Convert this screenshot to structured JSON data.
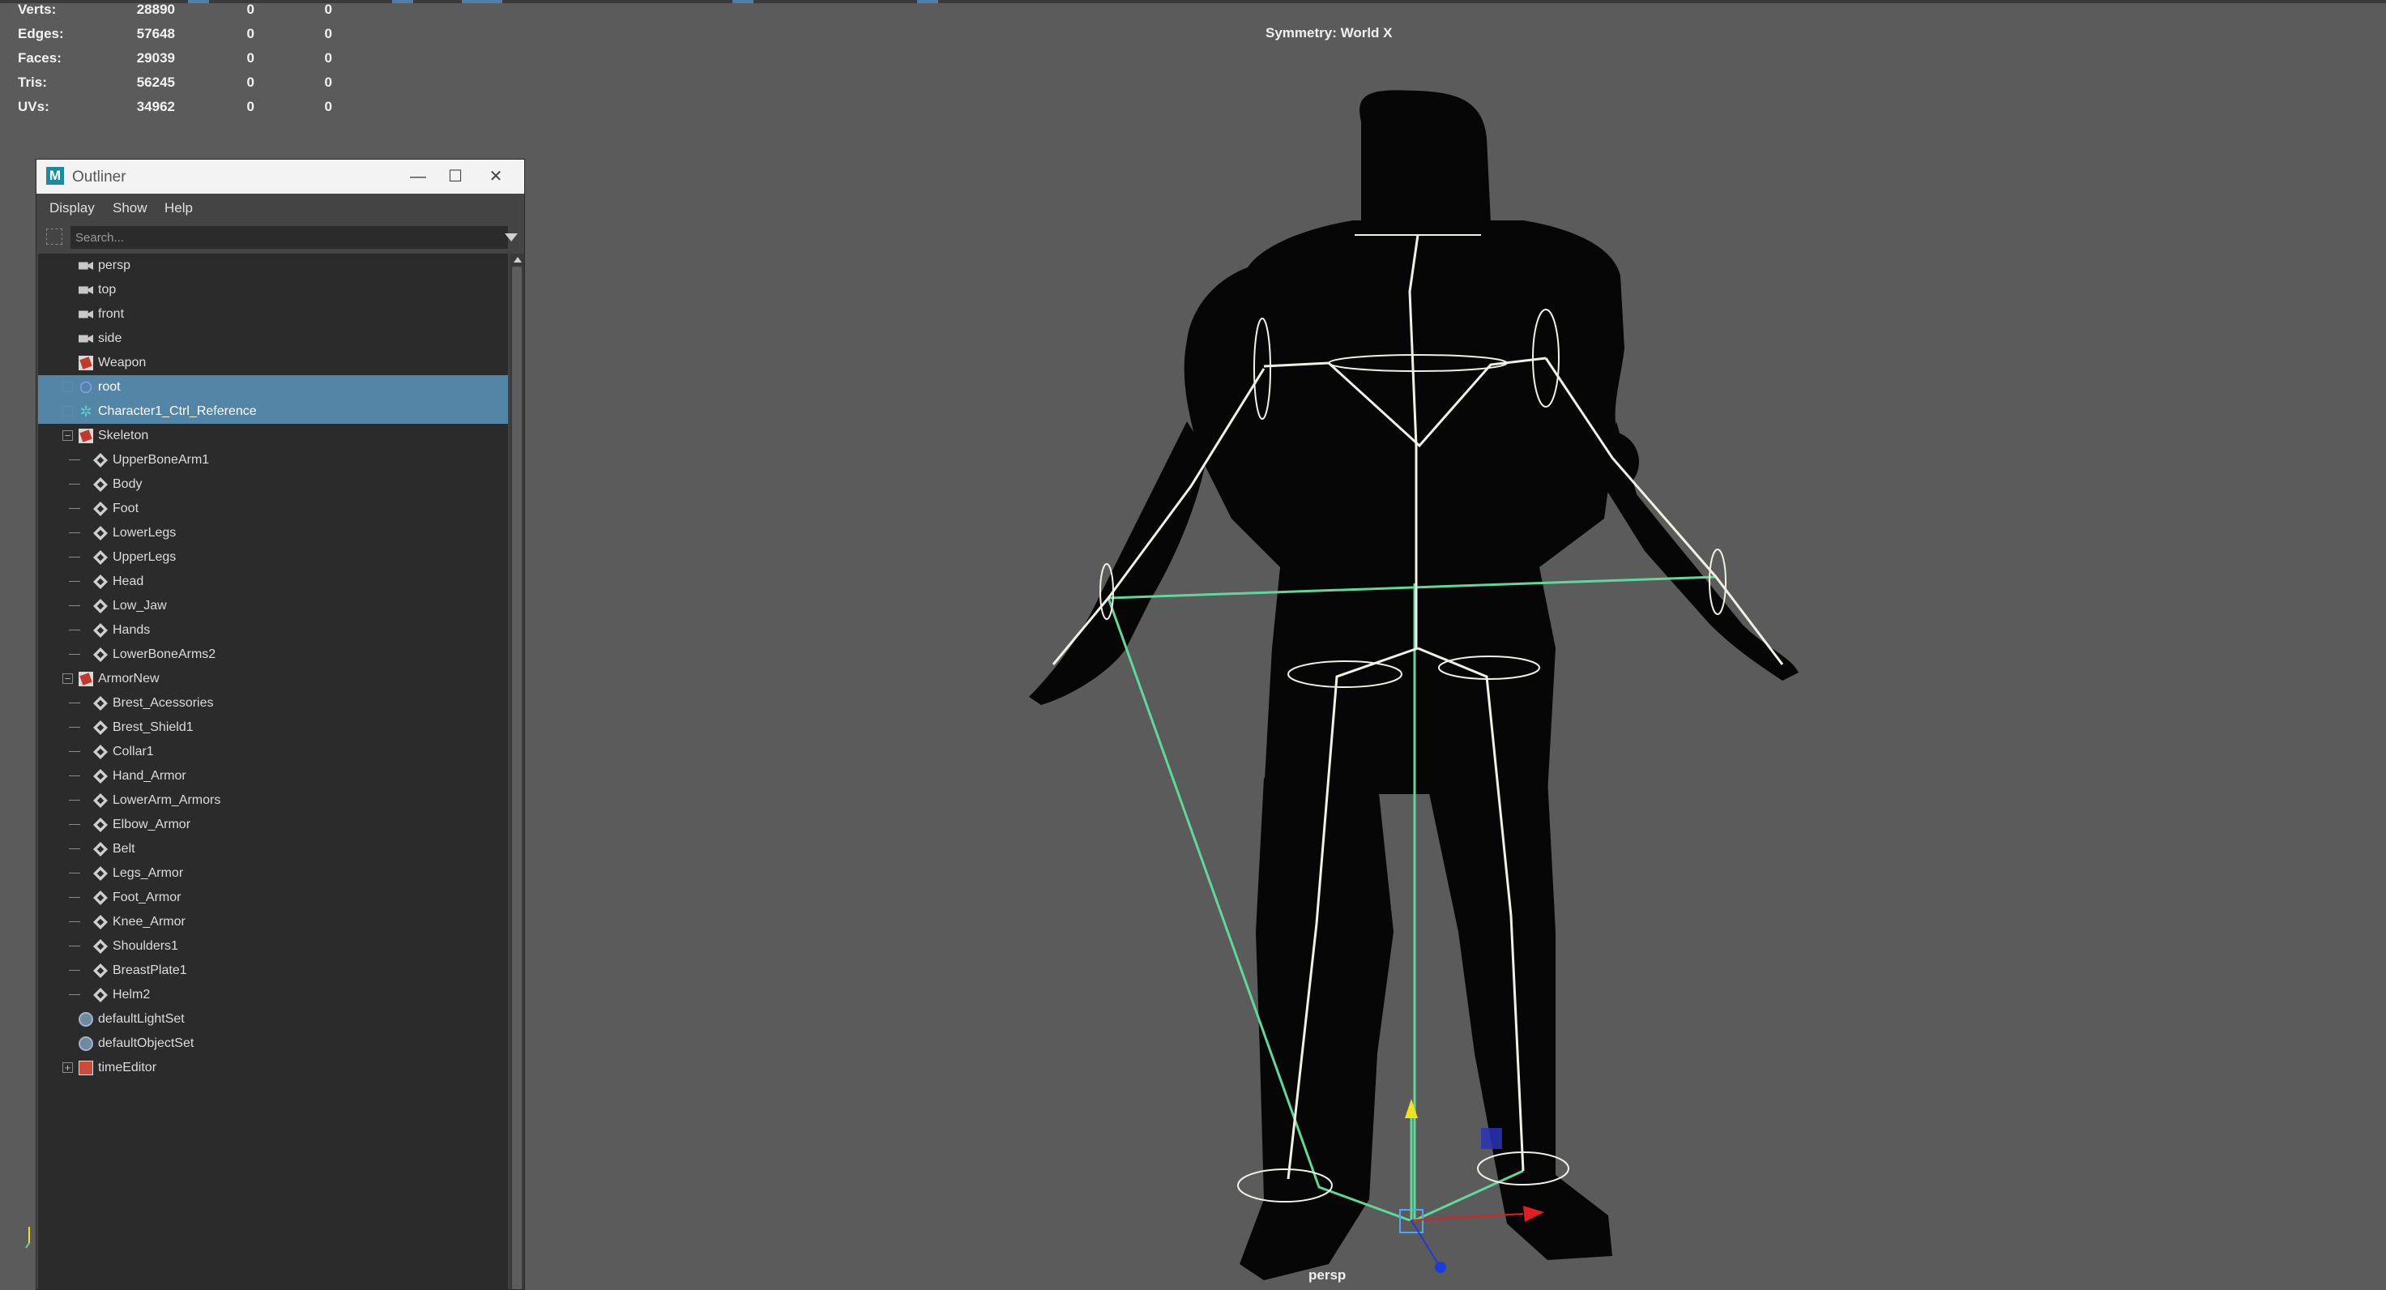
{
  "hud": {
    "stats": [
      {
        "label": "Verts:",
        "v1": "28890",
        "v2": "0",
        "v3": "0"
      },
      {
        "label": "Edges:",
        "v1": "57648",
        "v2": "0",
        "v3": "0"
      },
      {
        "label": "Faces:",
        "v1": "29039",
        "v2": "0",
        "v3": "0"
      },
      {
        "label": "Tris:",
        "v1": "56245",
        "v2": "0",
        "v3": "0"
      },
      {
        "label": "UVs:",
        "v1": "34962",
        "v2": "0",
        "v3": "0"
      }
    ],
    "symmetry": "Symmetry: World X",
    "camera": "persp"
  },
  "outliner": {
    "title": "Outliner",
    "logo": "M",
    "menu": [
      "Display",
      "Show",
      "Help"
    ],
    "search_placeholder": "Search...",
    "window_buttons": {
      "minimize": "—",
      "maximize": "☐",
      "close": "✕"
    },
    "items": [
      {
        "label": "persp",
        "icon": "camera-icon"
      },
      {
        "label": "top",
        "icon": "camera-icon"
      },
      {
        "label": "front",
        "icon": "camera-icon"
      },
      {
        "label": "side",
        "icon": "camera-icon"
      },
      {
        "label": "Weapon",
        "icon": "group-icon"
      },
      {
        "label": "root",
        "icon": "joint-icon",
        "selected": true
      },
      {
        "label": "Character1_Ctrl_Reference",
        "icon": "reference-icon",
        "selected": true
      },
      {
        "label": "Skeleton",
        "icon": "group-icon",
        "expanded": true
      },
      {
        "label": "UpperBoneArm1",
        "icon": "mesh-icon"
      },
      {
        "label": "Body",
        "icon": "mesh-icon"
      },
      {
        "label": "Foot",
        "icon": "mesh-icon"
      },
      {
        "label": "LowerLegs",
        "icon": "mesh-icon"
      },
      {
        "label": "UpperLegs",
        "icon": "mesh-icon"
      },
      {
        "label": "Head",
        "icon": "mesh-icon"
      },
      {
        "label": "Low_Jaw",
        "icon": "mesh-icon"
      },
      {
        "label": "Hands",
        "icon": "mesh-icon"
      },
      {
        "label": "LowerBoneArms2",
        "icon": "mesh-icon"
      },
      {
        "label": "ArmorNew",
        "icon": "group-icon",
        "expanded": true
      },
      {
        "label": "Brest_Acessories",
        "icon": "mesh-icon"
      },
      {
        "label": "Brest_Shield1",
        "icon": "mesh-icon"
      },
      {
        "label": "Collar1",
        "icon": "mesh-icon"
      },
      {
        "label": "Hand_Armor",
        "icon": "mesh-icon"
      },
      {
        "label": "LowerArm_Armors",
        "icon": "mesh-icon"
      },
      {
        "label": "Elbow_Armor",
        "icon": "mesh-icon"
      },
      {
        "label": "Belt",
        "icon": "mesh-icon"
      },
      {
        "label": "Legs_Armor",
        "icon": "mesh-icon"
      },
      {
        "label": "Foot_Armor",
        "icon": "mesh-icon"
      },
      {
        "label": "Knee_Armor",
        "icon": "mesh-icon"
      },
      {
        "label": "Shoulders1",
        "icon": "mesh-icon"
      },
      {
        "label": "BreastPlate1",
        "icon": "mesh-icon"
      },
      {
        "label": "Helm2",
        "icon": "mesh-icon"
      },
      {
        "label": "defaultLightSet",
        "icon": "set-icon"
      },
      {
        "label": "defaultObjectSet",
        "icon": "set-icon"
      },
      {
        "label": "timeEditor",
        "icon": "time-editor-icon",
        "collapsed": true
      }
    ]
  },
  "colors": {
    "viewport_bg": "#5b5b5b",
    "selection": "#5285a6",
    "joint": "#f0f0e6",
    "control": "#5fd89a",
    "axis_x": "#e02020",
    "axis_y": "#f0e020",
    "axis_z": "#1a3cd8"
  }
}
